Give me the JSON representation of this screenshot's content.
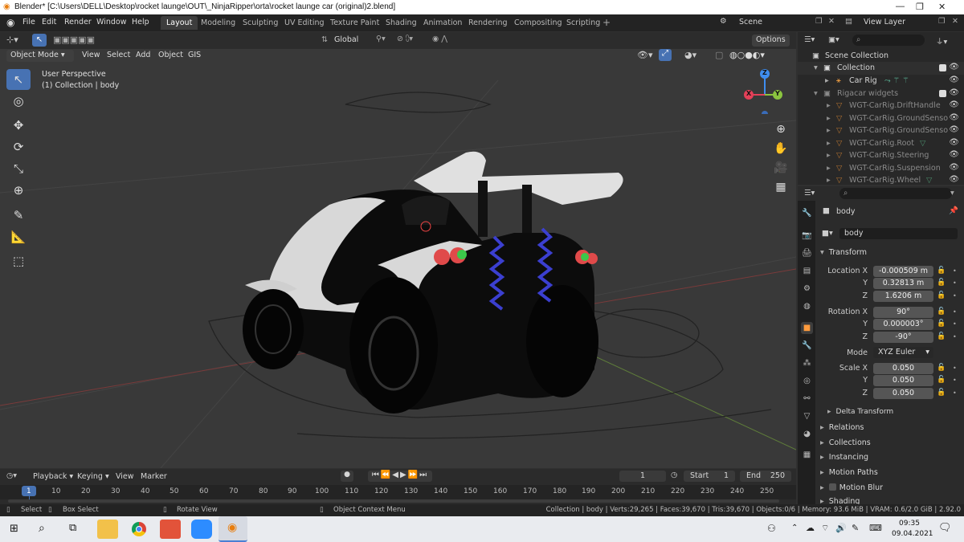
{
  "window": {
    "title": "Blender* [C:\\Users\\DELL\\Desktop\\rocket launge\\OUT\\_NinjaRipper\\orta\\rocket launge car (original)2.blend]"
  },
  "menu": [
    "File",
    "Edit",
    "Render",
    "Window",
    "Help"
  ],
  "workspaces": [
    "Layout",
    "Modeling",
    "Sculpting",
    "UV Editing",
    "Texture Paint",
    "Shading",
    "Animation",
    "Rendering",
    "Compositing",
    "Scripting"
  ],
  "scene": {
    "name": "Scene",
    "view_layer": "View Layer"
  },
  "viewport": {
    "mode": "Object Mode",
    "menus": [
      "View",
      "Select",
      "Add",
      "Object",
      "GIS"
    ],
    "orientation": "Global",
    "options_label": "Options",
    "perspective": "User Perspective",
    "collection_info": "(1) Collection | body",
    "axes": {
      "z": "Z",
      "y": "Y",
      "x": "X"
    }
  },
  "outliner": {
    "root": "Scene Collection",
    "collection": "Collection",
    "car_rig": "Car Rig",
    "rigacar": "Rigacar widgets",
    "widgets": [
      "WGT-CarRig.DriftHandle",
      "WGT-CarRig.GroundSenso",
      "WGT-CarRig.GroundSenso",
      "WGT-CarRig.Root",
      "WGT-CarRig.Steering",
      "WGT-CarRig.Suspension",
      "WGT-CarRig.Wheel"
    ]
  },
  "properties": {
    "object_name": "body",
    "data_name": "body",
    "transform_label": "Transform",
    "location_label": "Location X",
    "location": [
      "-0.000509 m",
      "0.32813 m",
      "1.6206 m"
    ],
    "rotation_label": "Rotation X",
    "rotation": [
      "90°",
      "0.000003°",
      "-90°"
    ],
    "mode_label": "Mode",
    "mode": "XYZ Euler",
    "scale_label": "Scale X",
    "scale": [
      "0.050",
      "0.050",
      "0.050"
    ],
    "y_label": "Y",
    "z_label": "Z",
    "delta": "Delta Transform",
    "sections": [
      "Relations",
      "Collections",
      "Instancing",
      "Motion Paths",
      "Motion Blur",
      "Shading"
    ]
  },
  "timeline": {
    "menus": [
      "Playback",
      "Keying",
      "View",
      "Marker"
    ],
    "current_frame": "1",
    "start_label": "Start",
    "start": "1",
    "end_label": "End",
    "end": "250",
    "ticks": [
      "1",
      "10",
      "20",
      "30",
      "40",
      "50",
      "60",
      "70",
      "80",
      "90",
      "100",
      "110",
      "120",
      "130",
      "140",
      "150",
      "160",
      "170",
      "180",
      "190",
      "200",
      "210",
      "220",
      "230",
      "240",
      "250"
    ]
  },
  "status": {
    "select": "Select",
    "box_select": "Box Select",
    "rotate_view": "Rotate View",
    "context_menu": "Object Context Menu",
    "stats": "Collection | body | Verts:29,265 | Faces:39,670 | Tris:39,670 | Objects:0/6 | Memory: 93.6 MiB | VRAM: 0.6/2.0 GiB | 2.92.0"
  },
  "taskbar": {
    "time": "09:35",
    "date": "09.04.2021"
  },
  "colors": {
    "accent": "#4772b3",
    "active_tab": "#ff9b3d",
    "axis_x": "#e44058",
    "axis_y": "#8bc53f",
    "axis_z": "#3f8ef0"
  }
}
